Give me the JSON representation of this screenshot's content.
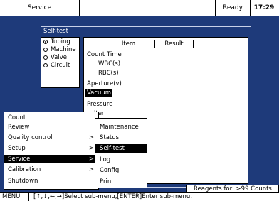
{
  "header": {
    "title": "Service",
    "status": "Ready",
    "time": "17:29"
  },
  "dialog": {
    "title": "Self-test"
  },
  "radio_options": [
    {
      "label": "Tubing",
      "selected": true
    },
    {
      "label": "Machine",
      "selected": false
    },
    {
      "label": "Valve",
      "selected": false
    },
    {
      "label": "Circuit",
      "selected": false
    }
  ],
  "table": {
    "col_item": "Item",
    "col_result": "Result",
    "rows": [
      {
        "label": "Count Time",
        "indent": 0
      },
      {
        "label": "WBC(s)",
        "indent": 1
      },
      {
        "label": "RBC(s)",
        "indent": 1
      },
      {
        "label": "Aperture(v)",
        "indent": 0
      },
      {
        "label": "Vacuum",
        "indent": 0,
        "selected": true
      },
      {
        "label": "Pressure",
        "indent": 0
      },
      {
        "label": "lter",
        "indent": 0
      }
    ]
  },
  "menu": [
    {
      "label": "Count",
      "arrow": ""
    },
    {
      "label": "Review",
      "arrow": ""
    },
    {
      "label": "Quality control",
      "arrow": ">"
    },
    {
      "label": "Setup",
      "arrow": ">"
    },
    {
      "label": "Service",
      "arrow": ">",
      "selected": true
    },
    {
      "label": "Calibration",
      "arrow": ">"
    },
    {
      "label": "Shutdown",
      "arrow": ""
    }
  ],
  "submenu": [
    {
      "label": "Maintenance"
    },
    {
      "label": "Status"
    },
    {
      "label": "Self-test",
      "selected": true
    },
    {
      "label": "Log"
    },
    {
      "label": "Config"
    },
    {
      "label": "Print"
    }
  ],
  "reagents": "Reagents for: >99 Counts",
  "statusbar": {
    "label": "MENU",
    "message": "[↑,↓,←,→]Select sub-menu,[ENTER]Enter sub-menu."
  },
  "colors": {
    "background": "#1e3a7a",
    "selection": "#000000"
  }
}
